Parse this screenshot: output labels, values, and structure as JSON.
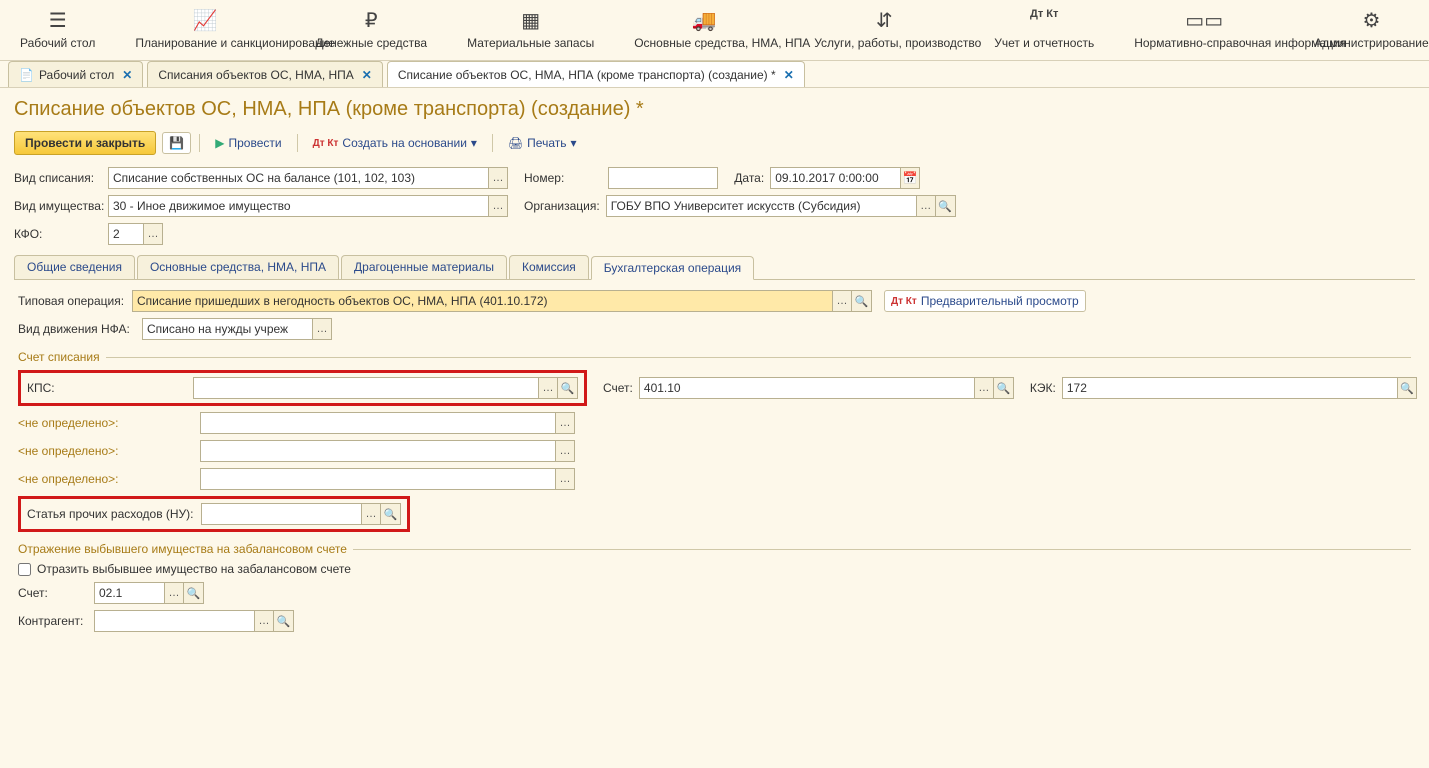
{
  "topnav": [
    {
      "label": "Рабочий стол",
      "icon": "☰"
    },
    {
      "label": "Планирование и санкционирование",
      "icon": "📈"
    },
    {
      "label": "Денежные средства",
      "icon": "₽"
    },
    {
      "label": "Материальные запасы",
      "icon": "▦"
    },
    {
      "label": "Основные средства, НМА, НПА",
      "icon": "🚚"
    },
    {
      "label": "Услуги, работы, производство",
      "icon": "⇵"
    },
    {
      "label": "Учет и отчетность",
      "icon": "Дт Кт"
    },
    {
      "label": "Нормативно-справочная информация",
      "icon": "▭▭"
    },
    {
      "label": "Администрирование",
      "icon": "⚙"
    }
  ],
  "tabs": [
    {
      "label": "Рабочий стол",
      "active": false
    },
    {
      "label": "Списания объектов ОС, НМА, НПА",
      "active": false
    },
    {
      "label": "Списание объектов ОС, НМА, НПА (кроме транспорта) (создание) *",
      "active": true
    }
  ],
  "page_title": "Списание объектов ОС, НМА, НПА (кроме транспорта) (создание) *",
  "toolbar": {
    "primary": "Провести и закрыть",
    "save": "💾",
    "provesti": "Провести",
    "create_based": "Создать на основании",
    "print": "Печать"
  },
  "header": {
    "writeoff_type_label": "Вид списания:",
    "writeoff_type_value": "Списание собственных ОС на балансе (101, 102, 103)",
    "number_label": "Номер:",
    "number_value": "",
    "date_label": "Дата:",
    "date_value": "09.10.2017 0:00:00",
    "property_type_label": "Вид имущества:",
    "property_type_value": "30 - Иное движимое имущество",
    "org_label": "Организация:",
    "org_value": "ГОБУ ВПО Университет искусств (Субсидия)",
    "kfo_label": "КФО:",
    "kfo_value": "2"
  },
  "subtabs": [
    "Общие сведения",
    "Основные средства, НМА, НПА",
    "Драгоценные материалы",
    "Комиссия",
    "Бухгалтерская операция"
  ],
  "panel": {
    "typical_op_label": "Типовая операция:",
    "typical_op_value": "Списание пришедших в негодность объектов ОС, НМА, НПА (401.10.172)",
    "preview_btn": "Предварительный просмотр",
    "nfa_move_label": "Вид движения НФА:",
    "nfa_move_value": "Списано на нужды учреж",
    "writeoff_account_section": "Счет списания",
    "kps_label": "КПС:",
    "account_label": "Счет:",
    "account_value": "401.10",
    "kek_label": "КЭК:",
    "kek_value": "172",
    "undefined": "<не определено>:",
    "article_label": "Статья прочих расходов (НУ):",
    "offbalance_section": "Отражение выбывшего имущества на забалансовом счете",
    "offbalance_check": "Отразить выбывшее имущество на забалансовом счете",
    "account2_label": "Счет:",
    "account2_value": "02.1",
    "counterparty_label": "Контрагент:"
  }
}
